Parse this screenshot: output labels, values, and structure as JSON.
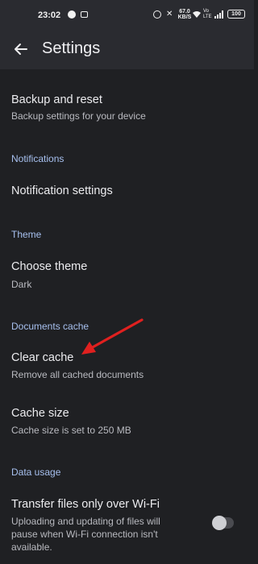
{
  "status_bar": {
    "time": "23:02",
    "net_speed_value": "67.0",
    "net_speed_unit": "KB/S",
    "vo_top": "Vo",
    "vo_bottom": "LTE",
    "battery": "100",
    "icons": [
      "messenger-icon",
      "camera-icon",
      "alarm-icon",
      "mute-icon",
      "wifi-icon",
      "signal-icon",
      "battery-icon"
    ]
  },
  "appbar": {
    "title": "Settings",
    "back_icon": "arrow-left-icon"
  },
  "items": {
    "backup": {
      "title": "Backup and reset",
      "subtitle": "Backup settings for your device"
    },
    "notifications_section": "Notifications",
    "notification_settings": {
      "title": "Notification settings"
    },
    "theme_section": "Theme",
    "choose_theme": {
      "title": "Choose theme",
      "subtitle": "Dark"
    },
    "documents_cache_section": "Documents cache",
    "clear_cache": {
      "title": "Clear cache",
      "subtitle": "Remove all cached documents"
    },
    "cache_size": {
      "title": "Cache size",
      "subtitle": "Cache size is set to 250 MB"
    },
    "data_usage_section": "Data usage",
    "transfer_wifi": {
      "title": "Transfer files only over Wi-Fi",
      "subtitle_line1": "Uploading and updating of files will",
      "subtitle_line2": "pause when Wi-Fi connection isn't",
      "subtitle_line3": "available.",
      "toggle_on": false
    }
  },
  "colors": {
    "background": "#1f2023",
    "appbar": "#2a2b30",
    "section_header": "#a7c0ef",
    "annotation_arrow": "#e0201f"
  }
}
